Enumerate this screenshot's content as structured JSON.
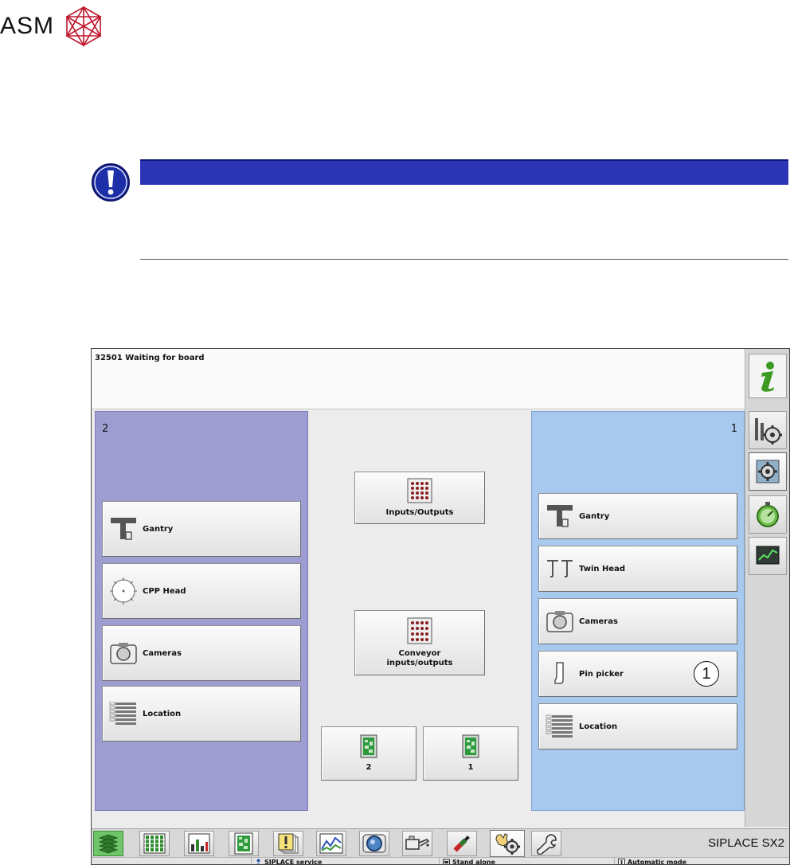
{
  "logo": {
    "text": "ASM"
  },
  "screen": {
    "message": "32501 Waiting for board",
    "left_panel": {
      "number": "2",
      "buttons": [
        {
          "label": "Gantry",
          "icon": "gantry-icon"
        },
        {
          "label": "CPP Head",
          "icon": "cpp-head-icon"
        },
        {
          "label": "Cameras",
          "icon": "camera-icon"
        },
        {
          "label": "Location",
          "icon": "location-icon"
        }
      ]
    },
    "center": {
      "io_label": "Inputs/Outputs",
      "conveyor_label_1": "Conveyor",
      "conveyor_label_2": "inputs/outputs",
      "conveyor_left_label": "2",
      "conveyor_right_label": "1"
    },
    "right_panel": {
      "number": "1",
      "buttons": [
        {
          "label": "Gantry",
          "icon": "gantry-icon"
        },
        {
          "label": "Twin Head",
          "icon": "twin-head-icon"
        },
        {
          "label": "Cameras",
          "icon": "camera-icon"
        },
        {
          "label": "Pin picker",
          "icon": "pin-picker-icon"
        },
        {
          "label": "Location",
          "icon": "location-icon"
        }
      ],
      "callout": "1"
    },
    "side_tabs": [
      "info-icon",
      "setup-gear-icon",
      "gear-active-icon",
      "stopwatch-icon",
      "monitor-icon"
    ],
    "taskbar": {
      "brand": "SIPLACE SX2",
      "buttons": [
        "production-icon",
        "feeder-table-icon",
        "statistics-icon",
        "board-icon",
        "messages-icon",
        "chart-icon",
        "vision-icon",
        "oil-can-icon",
        "nozzle-icon",
        "service-gear-icon",
        "wrench-icon"
      ]
    },
    "status": {
      "user": "SIPLACE service",
      "line": "Stand alone",
      "mode": "Automatic mode"
    }
  },
  "colors": {
    "left_panel": "#9e9dd2",
    "right_panel": "#a8c9ee",
    "notice_bar": "#2b35b5",
    "active_tab": "#6fc46a"
  }
}
